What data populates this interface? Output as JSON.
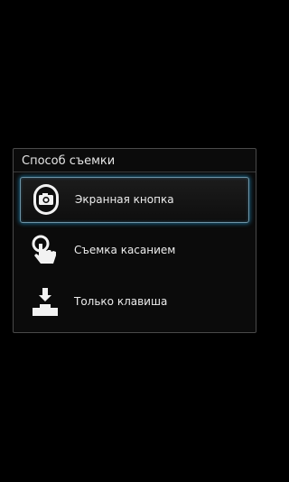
{
  "dialog": {
    "title": "Способ съемки",
    "options": [
      {
        "label": "Экранная кнопка",
        "icon": "camera-button-icon",
        "selected": true
      },
      {
        "label": "Съемка касанием",
        "icon": "touch-hand-icon",
        "selected": false
      },
      {
        "label": "Только клавиша",
        "icon": "hardware-key-icon",
        "selected": false
      }
    ]
  },
  "colors": {
    "background": "#000000",
    "highlight": "#28aae6",
    "text": "#ededed"
  }
}
